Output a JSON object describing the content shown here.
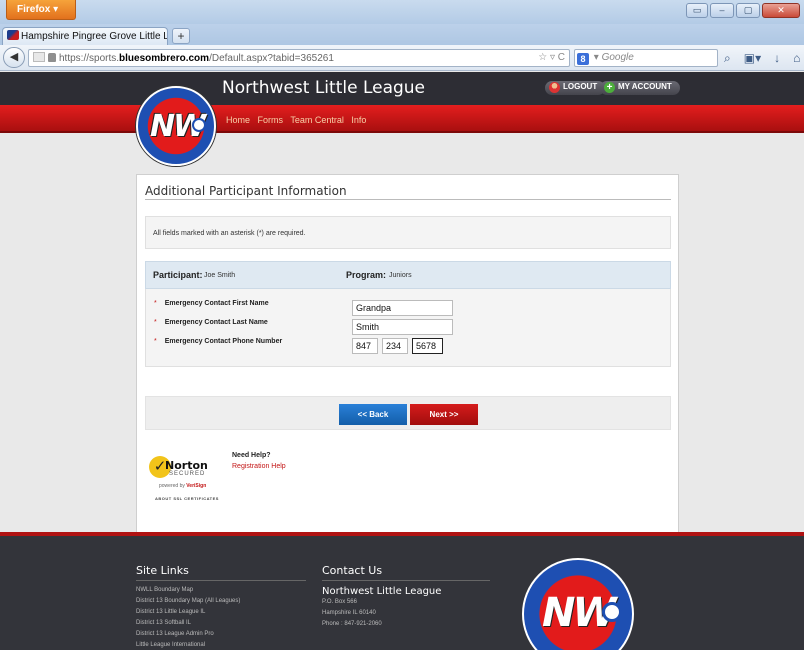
{
  "browser": {
    "app_button": "Firefox",
    "tab_title": "Hampshire Pingree Grove Little League ...",
    "url_prefix": "https://sports.",
    "url_domain": "bluesombrero.com",
    "url_path": "/Default.aspx?tabid=365261",
    "search_placeholder": "Google",
    "search_engine_letter": "8"
  },
  "header": {
    "site_title": "Northwest Little League",
    "logo_text": "NW",
    "logout_label": "LOGOUT",
    "account_label": "MY ACCOUNT",
    "nav": [
      "Home",
      "Forms",
      "Team Central",
      "Info"
    ]
  },
  "form": {
    "title": "Additional Participant Information",
    "required_notice": "All fields marked with an asterisk (*) are required.",
    "participant_label": "Participant:",
    "participant_value": "Joe Smith",
    "program_label": "Program:",
    "program_value": "Juniors",
    "fields": [
      {
        "label": "Emergency Contact First Name",
        "value": "Grandpa"
      },
      {
        "label": "Emergency Contact Last Name",
        "value": "Smith"
      },
      {
        "label": "Emergency Contact Phone Number",
        "phone": [
          "847",
          "234",
          "5678"
        ]
      }
    ],
    "back_label": "<< Back",
    "next_label": "Next >>"
  },
  "security": {
    "brand": "Norton",
    "secured": "SECURED",
    "powered_by": "powered by",
    "powered_brand": "VeriSign",
    "about": "ABOUT SSL CERTIFICATES",
    "help_title": "Need Help?",
    "help_link": "Registration Help"
  },
  "footer": {
    "site_links_title": "Site Links",
    "links": [
      "NWLL Boundary Map",
      "District 13 Boundary Map (All Leagues)",
      "District 13 Little League IL",
      "District 13 Softball IL",
      "District 13 League Admin Pro",
      "Little League International"
    ],
    "contact_title": "Contact Us",
    "org_name": "Northwest Little League",
    "address": [
      "P.O. Box 566",
      "Hampshire IL  60140",
      "Phone : 847-921-2060"
    ],
    "logo_ring_text": "NORTHWEST"
  },
  "colors": {
    "header_red": "#e41e1e",
    "header_dark": "#2d2d34",
    "back_blue": "#135ea9",
    "next_red": "#c31515"
  }
}
